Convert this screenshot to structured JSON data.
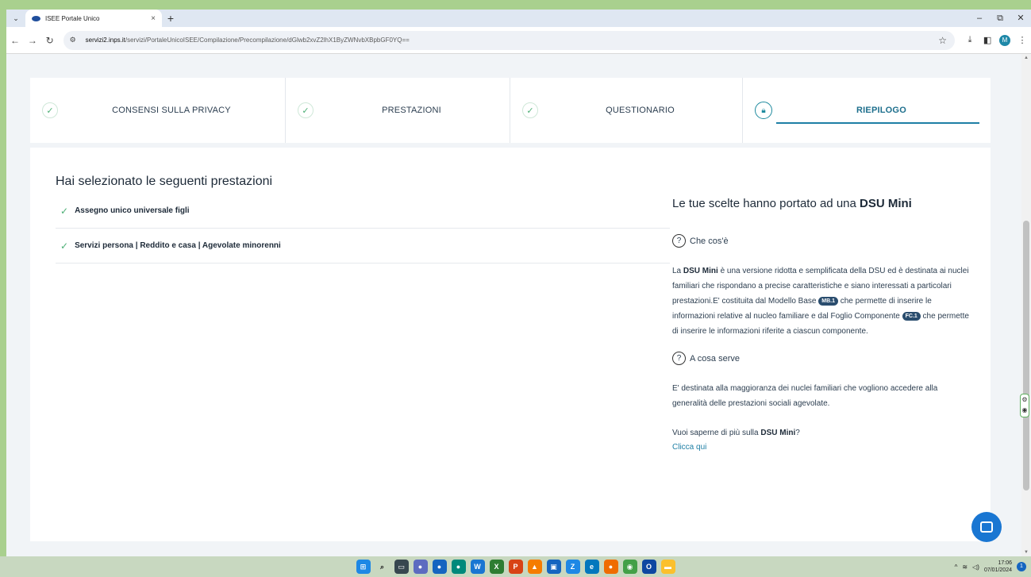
{
  "browser": {
    "tab_title": "ISEE Portale Unico",
    "url_domain": "servizi2.inps.it",
    "url_path": "/servizi/PortaleUnicoISEE/Compilazione/Precompilazione/dGlwb2xvZ2lhX1ByZWNvbXBpbGF0YQ==",
    "profile_initial": "M"
  },
  "stepper": {
    "steps": [
      {
        "label": "CONSENSI SULLA PRIVACY",
        "state": "done"
      },
      {
        "label": "PRESTAZIONI",
        "state": "done"
      },
      {
        "label": "QUESTIONARIO",
        "state": "done"
      },
      {
        "label": "RIEPILOGO",
        "state": "active"
      }
    ]
  },
  "summary": {
    "title": "Hai selezionato le seguenti prestazioni",
    "items": [
      "Assegno unico universale figli",
      "Servizi persona | Reddito e casa | Agevolate minorenni"
    ]
  },
  "dsu": {
    "title_prefix": "Le tue scelte hanno portato ad una ",
    "title_strong": "DSU Mini",
    "what_heading": "Che cos'è",
    "what_p1": "La ",
    "what_p1_strong": "DSU Mini",
    "what_p2": " è una versione ridotta e semplificata della DSU ed è destinata ai nuclei familiari che rispondano a precise caratteristiche e siano interessati a particolari prestazioni.E' costituita dal Modello Base ",
    "badge_mb": "MB.1",
    "what_p3": " che permette di inserire le informazioni relative al nucleo familiare e dal Foglio Componente ",
    "badge_fc": "FC.1",
    "what_p4": " che permette di inserire le informazioni riferite a ciascun componente.",
    "purpose_heading": "A cosa serve",
    "purpose_text": "E' destinata alla maggioranza dei nuclei familiari che vogliono accedere alla generalità delle prestazioni sociali agevolate.",
    "more_prefix": "Vuoi saperne di più sulla ",
    "more_strong": "DSU Mini",
    "more_suffix": "?",
    "link_text": "Clicca qui"
  },
  "taskbar": {
    "time": "17:06",
    "date": "07/01/2024"
  },
  "colors": {
    "accent": "#1e7fa5",
    "check": "#4caf75",
    "chat_button": "#1976d2"
  }
}
